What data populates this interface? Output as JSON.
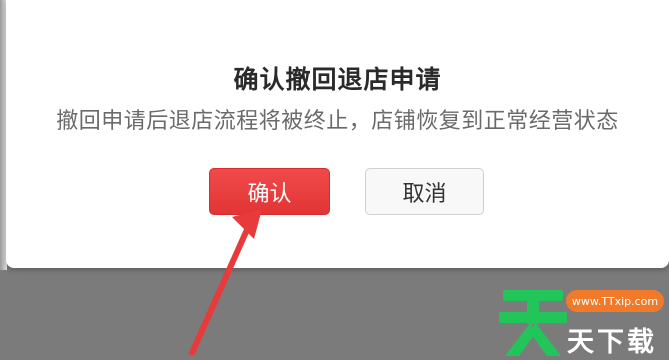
{
  "dialog": {
    "title": "确认撤回退店申请",
    "message": "撤回申请后退店流程将被终止，店铺恢复到正常经营状态",
    "confirm_label": "确认",
    "cancel_label": "取消"
  },
  "watermark": {
    "badge_text": "www.TTxip.com",
    "site_name": "天下载",
    "logo_glyph": "天"
  },
  "colors": {
    "confirm_button": "#e83a3a",
    "arrow": "#e83a3a",
    "watermark_green": "#22c55a",
    "watermark_orange": "#f07a2a"
  },
  "icons": {
    "annotation_arrow": "arrow-pointer",
    "watermark_logo": "green-tian-logo"
  }
}
